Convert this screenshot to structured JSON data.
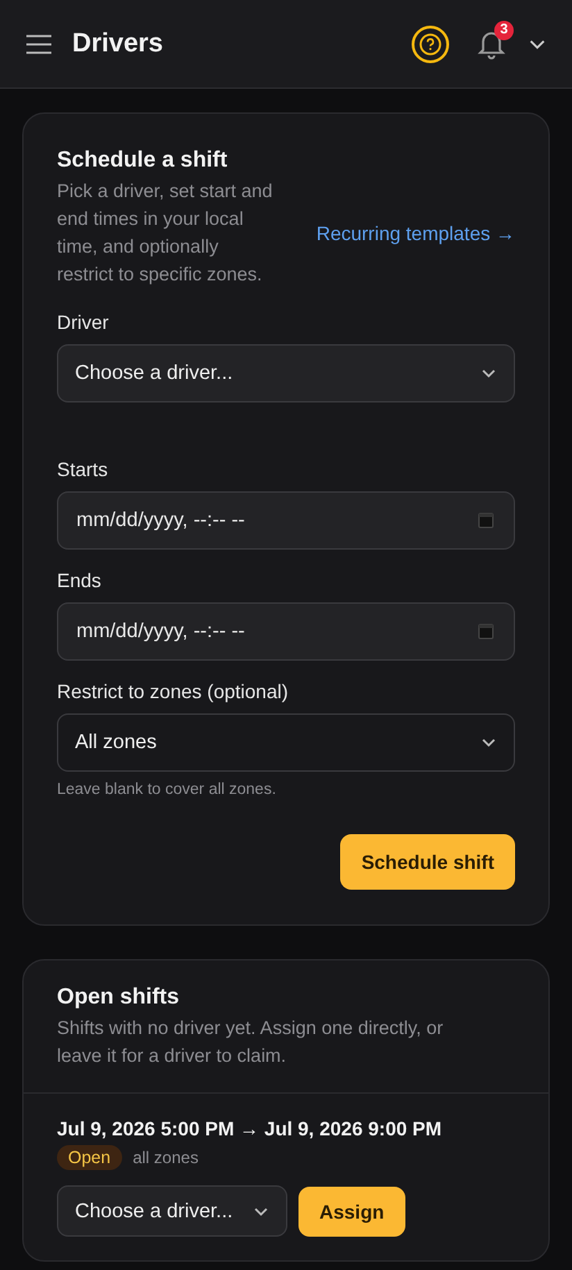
{
  "header": {
    "title": "Drivers",
    "notifications": "3"
  },
  "schedule": {
    "title": "Schedule a shift",
    "description": "Pick a driver, set start and end times in your local time, and optionally restrict to specific zones.",
    "link": "Recurring templates →",
    "fields": [
      {
        "kind": "select",
        "label": "Driver",
        "value": "Choose a driver..."
      },
      {
        "kind": "datetime",
        "label": "Starts",
        "placeholder": "mm/dd/yyyy, --:-- --"
      },
      {
        "kind": "datetime",
        "label": "Ends",
        "placeholder": "mm/dd/yyyy, --:-- --"
      },
      {
        "kind": "select",
        "label": "Restrict to zones (optional)",
        "value": "All zones",
        "hint": "Leave blank to cover all zones."
      }
    ],
    "button": "Schedule shift"
  },
  "open_shifts": {
    "title": "Open shifts",
    "description": "Shifts with no driver yet. Assign one directly, or leave it for a driver to claim.",
    "shifts": [
      {
        "time": "Jul 9, 2026 5:00 PM → Jul 9, 2026 9:00 PM",
        "status": "Open",
        "zones": "all zones",
        "driver": "Choose a driver...",
        "button": "Assign"
      }
    ]
  }
}
